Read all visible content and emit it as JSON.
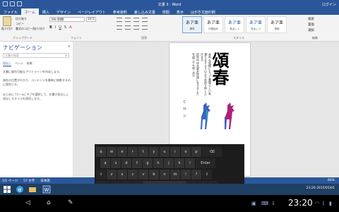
{
  "window": {
    "title": "文書 3 - Word",
    "user": "ログイン"
  },
  "tabs": [
    {
      "label": "ファイル"
    },
    {
      "label": "ホーム"
    },
    {
      "label": "挿入"
    },
    {
      "label": "デザイン"
    },
    {
      "label": "ページレイアウト"
    },
    {
      "label": "参考資料"
    },
    {
      "label": "差し込み文書"
    },
    {
      "label": "校閲"
    },
    {
      "label": "表示"
    },
    {
      "label": "はがき文面印刷"
    }
  ],
  "ribbon": {
    "clipboard_label": "クリップボード",
    "paste": "貼り付け",
    "cut": "切り取り",
    "copy": "コピー",
    "format_painter": "書式のコピー/貼り付け",
    "font_name": "MS 明朝",
    "font_size": "10.5",
    "font_group": "フォント",
    "paragraph_group": "段落",
    "styles_group": "スタイル",
    "styles": [
      {
        "sample": "あア亜",
        "name": "標準"
      },
      {
        "sample": "あア亜",
        "name": "行間詰め"
      },
      {
        "sample": "あア亜",
        "name": "見出し 1"
      },
      {
        "sample": "あア亜",
        "name": "見出し 2"
      },
      {
        "sample": "あア亜",
        "name": "表題"
      }
    ],
    "edit": {
      "find": "検索",
      "replace": "置換",
      "select": "選択"
    },
    "edit_group": "編集"
  },
  "nav": {
    "title": "ナビゲーション",
    "search_placeholder": "文書の検索",
    "tabs": [
      "見出し",
      "ページ",
      "結果"
    ],
    "para1": "文書に操作可能なアウトラインを作成します。",
    "para2": "現在の位置がわかり、コンテンツを簡単に移動するのに便利です。",
    "para3": "はじめに [ホーム] タブを選択して、文書の見出しに見出しスタイルを適用します。"
  },
  "document": {
    "kanji": "頌春",
    "column1": "本年も皆様にとって素晴らしい年で",
    "column2": "ありますよう心よりお祈り申し上げます",
    "column3": "旧年中は大変お世話になりました",
    "column4": "平成二十七年 元旦",
    "signature": "ヒロシ"
  },
  "status": {
    "page": "1/1 ページ",
    "words": "57 文字",
    "lang": "日本語",
    "zoom": "66%"
  },
  "keyboard": {
    "row1": [
      "q",
      "w",
      "e",
      "r",
      "t",
      "y",
      "u",
      "i",
      "o",
      "p",
      "⌫"
    ],
    "row2": [
      "a",
      "s",
      "d",
      "f",
      "g",
      "h",
      "j",
      "k",
      "l",
      "Enter"
    ],
    "row3": [
      "⇧",
      "z",
      "x",
      "c",
      "v",
      "b",
      "n",
      "m",
      "!",
      "?",
      "⇧"
    ],
    "row4": [
      "&123",
      "Ctrl",
      "☻",
      "A",
      "",
      "<",
      ">",
      "⌨"
    ]
  },
  "taskbar": {
    "time": "23:20",
    "date": "2015/01/01"
  },
  "android": {
    "clock": "23:20"
  }
}
